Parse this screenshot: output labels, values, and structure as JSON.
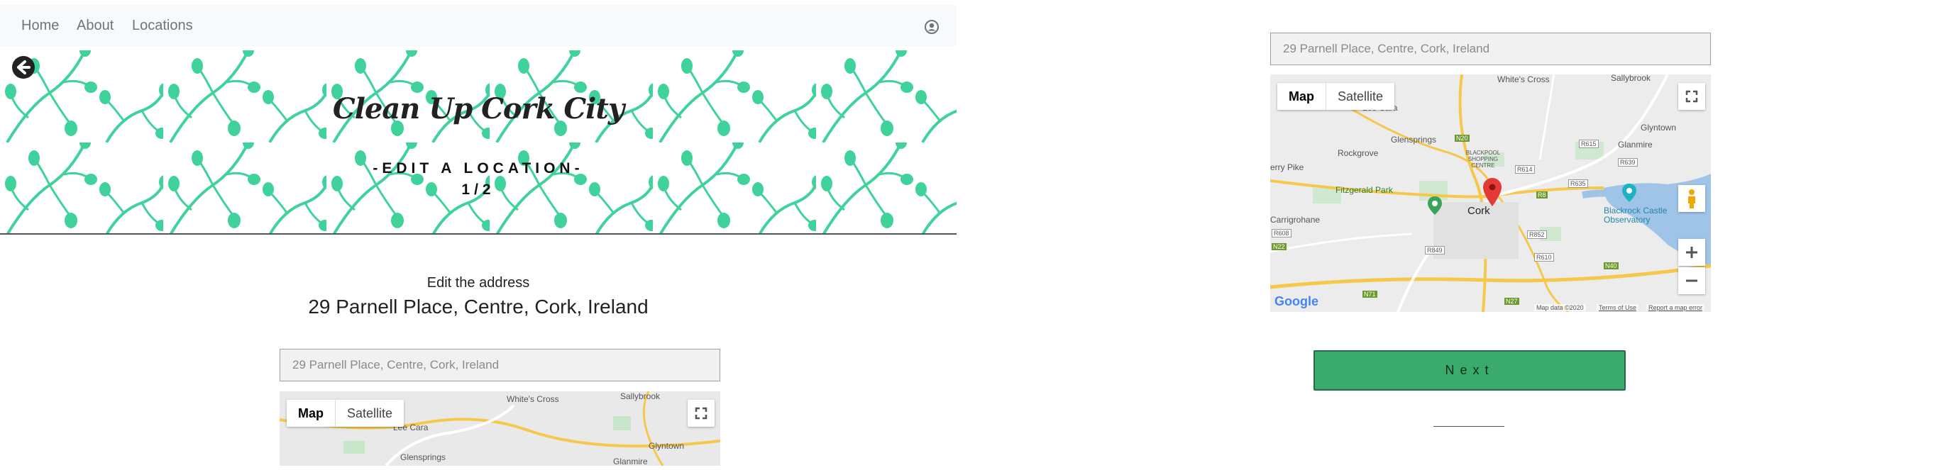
{
  "navbar": {
    "links": [
      "Home",
      "About",
      "Locations"
    ],
    "user_icon": "user-circle-icon"
  },
  "hero": {
    "title": "Clean Up Cork City",
    "heading": "-EDIT A LOCATION-",
    "step": "1/2",
    "back_icon": "arrow-left-circle-icon",
    "pattern_color": "#3fd29a"
  },
  "edit": {
    "label": "Edit the address",
    "current_address": "29 Parnell Place, Centre, Cork, Ireland",
    "input_placeholder": "29 Parnell Place, Centre, Cork, Ireland"
  },
  "map": {
    "type_options": [
      "Map",
      "Satellite"
    ],
    "selected_type": "Map",
    "fullscreen_icon": "fullscreen-icon",
    "zoom_in_icon": "plus-icon",
    "zoom_out_icon": "minus-icon",
    "pegman_icon": "pegman-icon",
    "marker_icon": "map-pin-icon",
    "labels": {
      "whites_cross": "White's Cross",
      "sallybrook": "Sallybrook",
      "lee_cara": "Lee Cara",
      "glenville": "Glyntown",
      "glensprings": "Glensprings",
      "rockgrove": "Rockgrove",
      "glanmire": "Glanmire",
      "blackpool": "BLACKPOOL SHOPPING CENTRE",
      "kerry_pike": "erry Pike",
      "fitzgerald": "Fitzgerald Park",
      "cork": "Cork",
      "carrigrohane": "Carrigrohane",
      "blackrock": "Blackrock Castle Observatory",
      "road_n20": "N20",
      "road_n22": "N22",
      "road_n40": "N40",
      "road_n71": "N71",
      "road_n27": "N27",
      "road_r608": "R608",
      "road_r615": "R615",
      "road_r639": "R639",
      "road_r614": "R614",
      "road_r635": "R635",
      "road_r852": "R852",
      "road_r610": "R610",
      "road_r849": "R849",
      "road_r8": "R8",
      "google": "Google",
      "map_data": "Map data ©2020",
      "terms": "Terms of Use",
      "report": "Report a map error"
    }
  },
  "actions": {
    "next_label": "Next"
  },
  "colors": {
    "navbar_bg": "#f8f9fa",
    "next_bg": "#3aaa6d",
    "pattern": "#3fd29a",
    "marker": "#e53935"
  }
}
